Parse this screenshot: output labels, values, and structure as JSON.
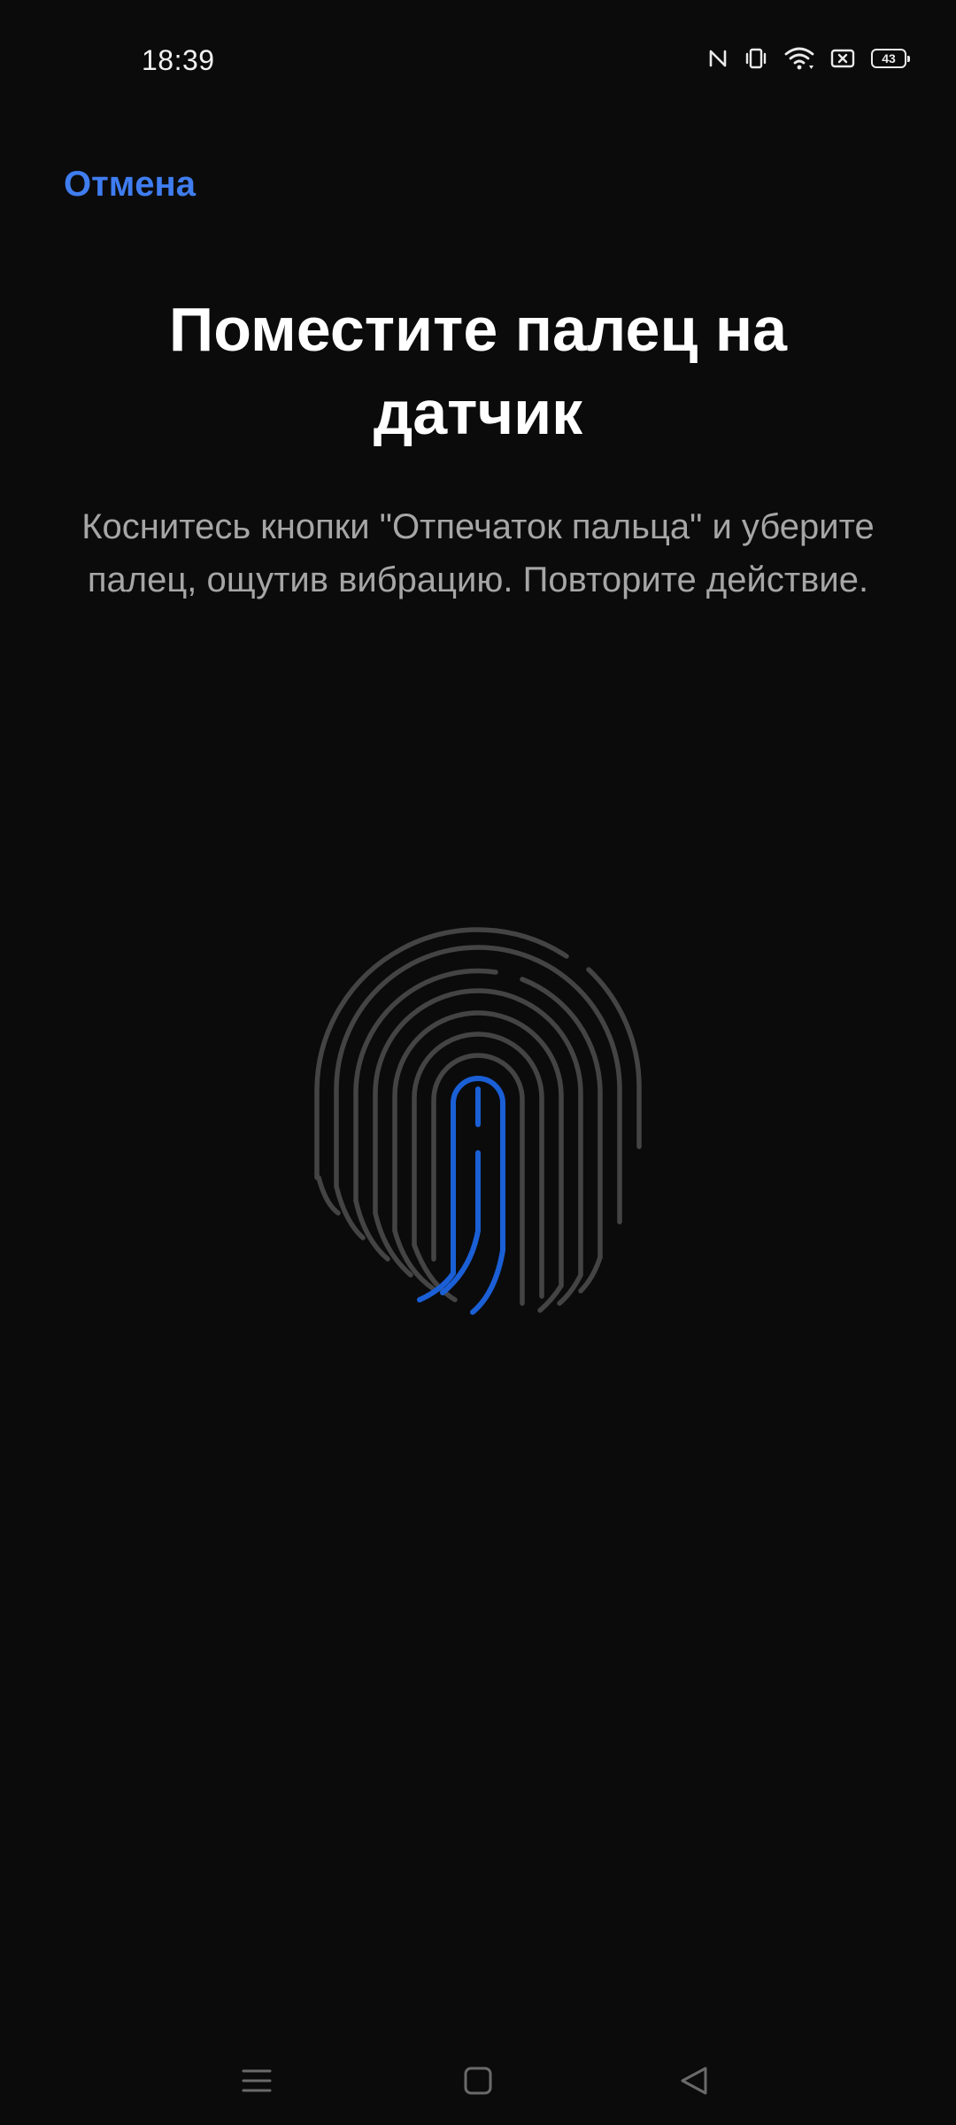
{
  "status_bar": {
    "time": "18:39",
    "icons": [
      "nfc-icon",
      "vibrate-icon",
      "wifi-icon",
      "sim-off-icon",
      "battery-icon"
    ],
    "battery_level": "43"
  },
  "header": {
    "cancel_label": "Отмена"
  },
  "main": {
    "title": "Поместите палец на датчик",
    "instruction": "Коснитесь кнопки \"Отпечаток пальца\" и уберите палец, ощутив вибрацию. Повторите действие."
  },
  "fingerprint": {
    "icon": "fingerprint-icon",
    "progress_fraction": 0.1,
    "colors": {
      "inactive": "#444444",
      "active": "#1a5fd6"
    }
  },
  "navigation_bar": {
    "buttons": [
      "menu-icon",
      "home-icon",
      "back-icon"
    ]
  },
  "colors": {
    "background": "#0b0b0b",
    "accent": "#3f7df0",
    "text_primary": "#ffffff",
    "text_secondary": "#a6a6a6"
  }
}
